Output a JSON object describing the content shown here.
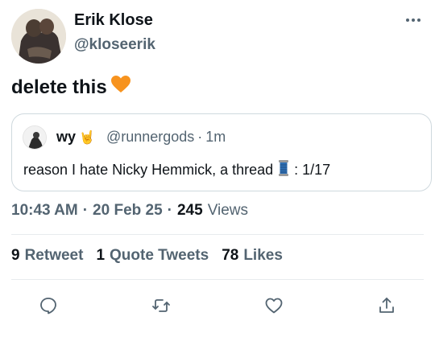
{
  "author": {
    "name": "Erik Klose",
    "handle": "@kloseerik"
  },
  "tweet": {
    "text": "delete this",
    "emoji": "🧡"
  },
  "quote": {
    "name": "wy",
    "name_emoji": "🤘",
    "handle": "@runnergods",
    "separator": "·",
    "time": "1m",
    "text": "reason I hate Nicky Hemmick, a thread",
    "text_emoji": "🧵",
    "text_suffix": ": 1/17"
  },
  "meta": {
    "time": "10:43 AM",
    "sep1": "·",
    "date": "20 Feb 25",
    "sep2": "·",
    "views_count": "245",
    "views_label": "Views"
  },
  "stats": {
    "retweets_count": "9",
    "retweets_label": "Retweet",
    "quotes_count": "1",
    "quotes_label": "Quote Tweets",
    "likes_count": "78",
    "likes_label": "Likes"
  },
  "icons": {
    "more": "more-horizontal-icon",
    "reply": "reply-icon",
    "retweet": "retweet-icon",
    "like": "heart-icon",
    "share": "share-icon"
  },
  "colors": {
    "text": "#0f1419",
    "secondary": "#536471",
    "border": "#cfd9de",
    "heart": "#f7931e"
  }
}
